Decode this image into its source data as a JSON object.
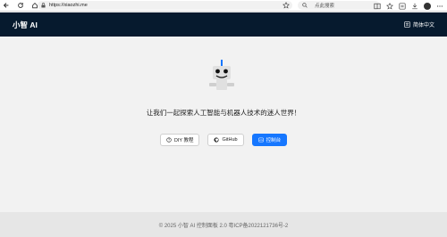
{
  "browser": {
    "url": "https://xiaozhi.me",
    "search_placeholder": "点此搜索"
  },
  "header": {
    "title": "小智 AI",
    "lang_label": "简体中文"
  },
  "main": {
    "tagline": "让我们一起探索人工智能与机器人技术的迷人世界！",
    "buttons": {
      "diy": "DIY 教程",
      "github": "GitHub",
      "console": "控制台"
    }
  },
  "footer": {
    "text": "© 2025 小智 AI 控制面板 2.0 粤ICP备2022121736号-2"
  },
  "colors": {
    "header_bg": "#061a2e",
    "primary": "#1677ff",
    "robot_antenna": "#1677ff"
  }
}
